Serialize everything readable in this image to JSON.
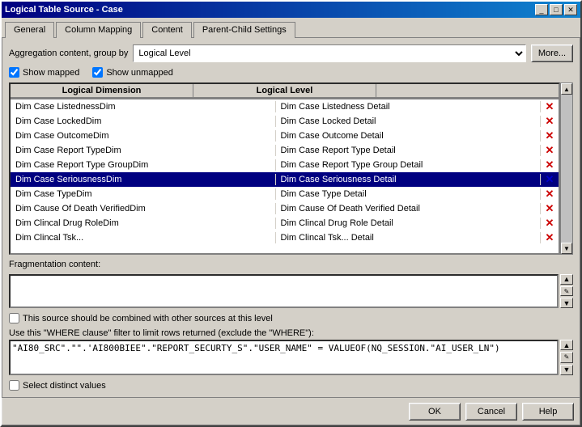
{
  "window": {
    "title": "Logical Table Source - Case",
    "controls": [
      "_",
      "□",
      "X"
    ]
  },
  "tabs": [
    {
      "label": "General"
    },
    {
      "label": "Column Mapping"
    },
    {
      "label": "Content",
      "active": true
    },
    {
      "label": "Parent-Child Settings"
    }
  ],
  "content": {
    "aggregation_label": "Aggregation content, group by",
    "aggregation_value": "Logical Level",
    "more_btn": "More...",
    "show_mapped_label": "Show mapped",
    "show_unmapped_label": "Show unmapped",
    "table": {
      "col1": "Logical Dimension",
      "col2": "Logical Level",
      "rows": [
        {
          "dim": "Dim Case ListednessDim",
          "level": "Dim Case Listedness Detail",
          "selected": false
        },
        {
          "dim": "Dim Case LockedDim",
          "level": "Dim Case Locked Detail",
          "selected": false
        },
        {
          "dim": "Dim Case OutcomeDim",
          "level": "Dim Case Outcome Detail",
          "selected": false
        },
        {
          "dim": "Dim Case Report TypeDim",
          "level": "Dim Case Report Type Detail",
          "selected": false
        },
        {
          "dim": "Dim Case Report Type GroupDim",
          "level": "Dim Case Report Type Group Detail",
          "selected": false
        },
        {
          "dim": "Dim Case SeriousnessDim",
          "level": "Dim Case Seriousness Detail",
          "selected": true
        },
        {
          "dim": "Dim Case TypeDim",
          "level": "Dim Case Type Detail",
          "selected": false
        },
        {
          "dim": "Dim Cause Of Death VerifiedDim",
          "level": "Dim Cause Of Death Verified Detail",
          "selected": false
        },
        {
          "dim": "Dim Clincal Drug RoleDim",
          "level": "Dim Clincal Drug Role Detail",
          "selected": false
        },
        {
          "dim": "Dim Clincal Tsk...",
          "level": "Dim Clincal Tsk... Detail",
          "selected": false
        }
      ]
    },
    "fragmentation_label": "Fragmentation content:",
    "combine_checkbox_label": "This source should be combined with other sources at this level",
    "where_label": "Use this \"WHERE clause\" filter to limit rows returned (exclude the \"WHERE\"):",
    "where_value": "\"AI80_SRC\".\"\".'AI800BIEE\".\"REPORT_SECURTY_S\".\"USER_NAME\" = VALUEOF(NQ_SESSION.\"AI_USER_LN\")",
    "distinct_checkbox_label": "Select distinct values",
    "buttons": {
      "ok": "OK",
      "cancel": "Cancel",
      "help": "Help"
    }
  }
}
